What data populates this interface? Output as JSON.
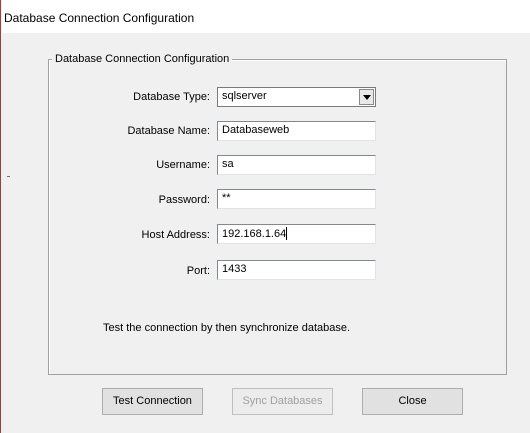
{
  "window": {
    "title": "Database Connection Configuration"
  },
  "group": {
    "legend": "Database Connection Configuration"
  },
  "fields": {
    "database_type": {
      "label": "Database Type:",
      "value": "sqlserver"
    },
    "database_name": {
      "label": "Database Name:",
      "value": "Databaseweb"
    },
    "username": {
      "label": "Username:",
      "value": "sa"
    },
    "password": {
      "label": "Password:",
      "value": "**"
    },
    "host_address": {
      "label": "Host Address:",
      "value": "192.168.1.64"
    },
    "port": {
      "label": "Port:",
      "value": "1433"
    }
  },
  "note": "Test the connection by then synchronize database.",
  "buttons": {
    "test_connection": "Test Connection",
    "sync_databases": "Sync Databases",
    "close": "Close"
  },
  "colors": {
    "window_background": "#f0f0f0",
    "title_background": "#ffffff",
    "left_border": "#a93a3a",
    "disabled_text": "#a0a0a0"
  }
}
